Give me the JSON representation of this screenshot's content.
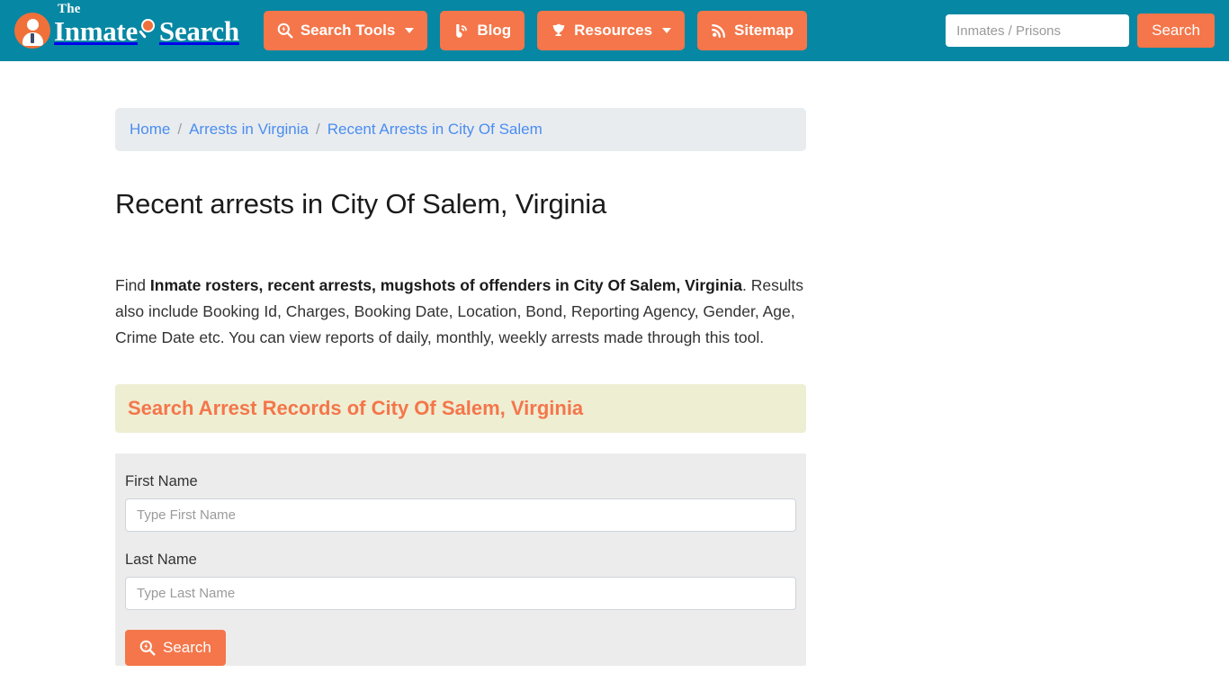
{
  "header": {
    "logo": {
      "the": "The",
      "word1": "Inmate",
      "word2": "Search",
      "person_icon": "person-icon",
      "magnifier_icon": "magnifier-icon"
    },
    "nav": [
      {
        "label": "Search Tools",
        "icon": "magnifier-bolt-icon",
        "has_caret": true
      },
      {
        "label": "Blog",
        "icon": "blog-b-icon",
        "has_caret": false
      },
      {
        "label": "Resources",
        "icon": "leaf-icon",
        "has_caret": true
      },
      {
        "label": "Sitemap",
        "icon": "rss-icon",
        "has_caret": false
      }
    ],
    "search": {
      "placeholder": "Inmates / Prisons",
      "value": "",
      "button_label": "Search"
    }
  },
  "breadcrumb": {
    "items": [
      {
        "label": "Home"
      },
      {
        "label": "Arrests in Virginia"
      },
      {
        "label": "Recent Arrests in City Of Salem"
      }
    ],
    "separator": "/"
  },
  "main": {
    "page_title": "Recent arrests in City Of Salem, Virginia",
    "description": {
      "lead": "Find ",
      "bold": "Inmate rosters, recent arrests, mugshots of offenders in City Of Salem, Virginia",
      "rest": ". Results also include Booking Id, Charges, Booking Date, Location, Bond, Reporting Agency, Gender, Age, Crime Date etc. You can view reports of daily, monthly, weekly arrests made through this tool."
    },
    "section_bar_title": "Search Arrest Records of City Of Salem, Virginia",
    "form": {
      "first_name_label": "First Name",
      "first_name_placeholder": "Type First Name",
      "first_name_value": "",
      "last_name_label": "Last Name",
      "last_name_placeholder": "Type Last Name",
      "last_name_value": "",
      "submit_label": "Search",
      "submit_icon": "magnifier-bolt-icon"
    }
  },
  "colors": {
    "header_teal": "#0687a3",
    "accent_orange": "#f4764a",
    "breadcrumb_bg": "#e9ecef",
    "section_bar_bg": "#eeeed3",
    "form_bg": "#ececec",
    "link_blue": "#4a8df0"
  }
}
